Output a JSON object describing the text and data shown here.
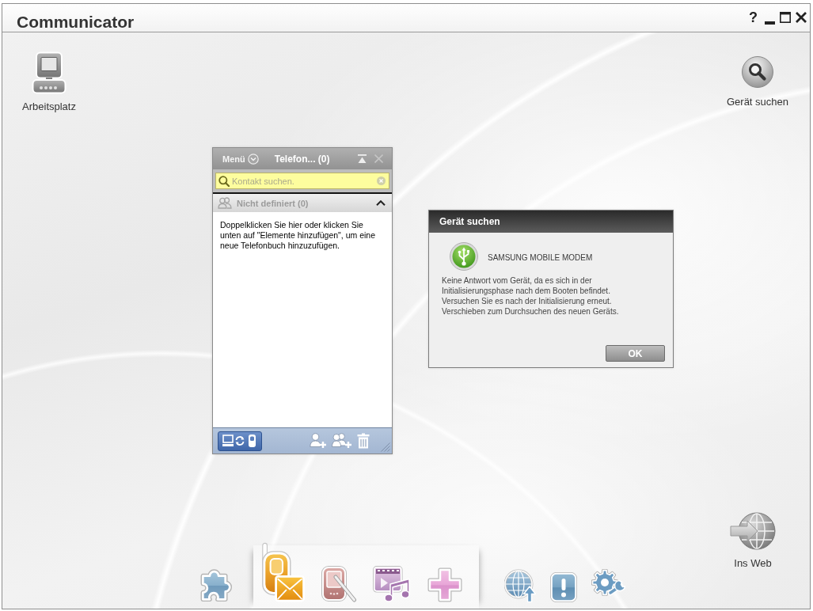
{
  "window": {
    "title": "Communicator",
    "help": "?"
  },
  "desktop_icons": [
    {
      "kind": "computer",
      "label": "Arbeitsplatz"
    },
    {
      "kind": "search",
      "label": "Gerät suchen"
    },
    {
      "kind": "web",
      "label": "Ins Web"
    }
  ],
  "phonebook": {
    "menu": "Menü",
    "title": "Telefon... (0)",
    "search": {
      "placeholder": "Kontakt suchen."
    },
    "group": {
      "label": "Nicht definiert (0)",
      "expanded": true
    },
    "hint": "Doppelklicken Sie hier oder klicken Sie unten auf \"Elemente hinzufügen\", um eine neue Telefonbuch hinzuzufügen.",
    "sync_button": {
      "on": true
    }
  },
  "dialog": {
    "title": "Gerät suchen",
    "device": "SAMSUNG MOBILE MODEM",
    "message": "Keine Antwort vom Gerät, da es sich in der Initialisierungsphase nach dem Booten befindet. Versuchen Sie es nach der Initialisierung erneut. Verschieben zum Durchsuchen des neuen Geräts.",
    "buttons": [
      "OK"
    ]
  },
  "dock": {
    "groups": [
      {
        "highlighted": false,
        "items": [
          {
            "kind": "puzzle",
            "selected": false
          }
        ]
      },
      {
        "highlighted": true,
        "items": [
          {
            "kind": "phone-mail",
            "selected": true
          },
          {
            "kind": "pda",
            "selected": false
          },
          {
            "kind": "media",
            "selected": false
          },
          {
            "kind": "plus",
            "selected": false
          }
        ]
      },
      {
        "highlighted": false,
        "items": [
          {
            "kind": "globe-upload",
            "selected": false
          },
          {
            "kind": "alert",
            "selected": false
          },
          {
            "kind": "gear",
            "selected": false
          }
        ]
      }
    ]
  }
}
